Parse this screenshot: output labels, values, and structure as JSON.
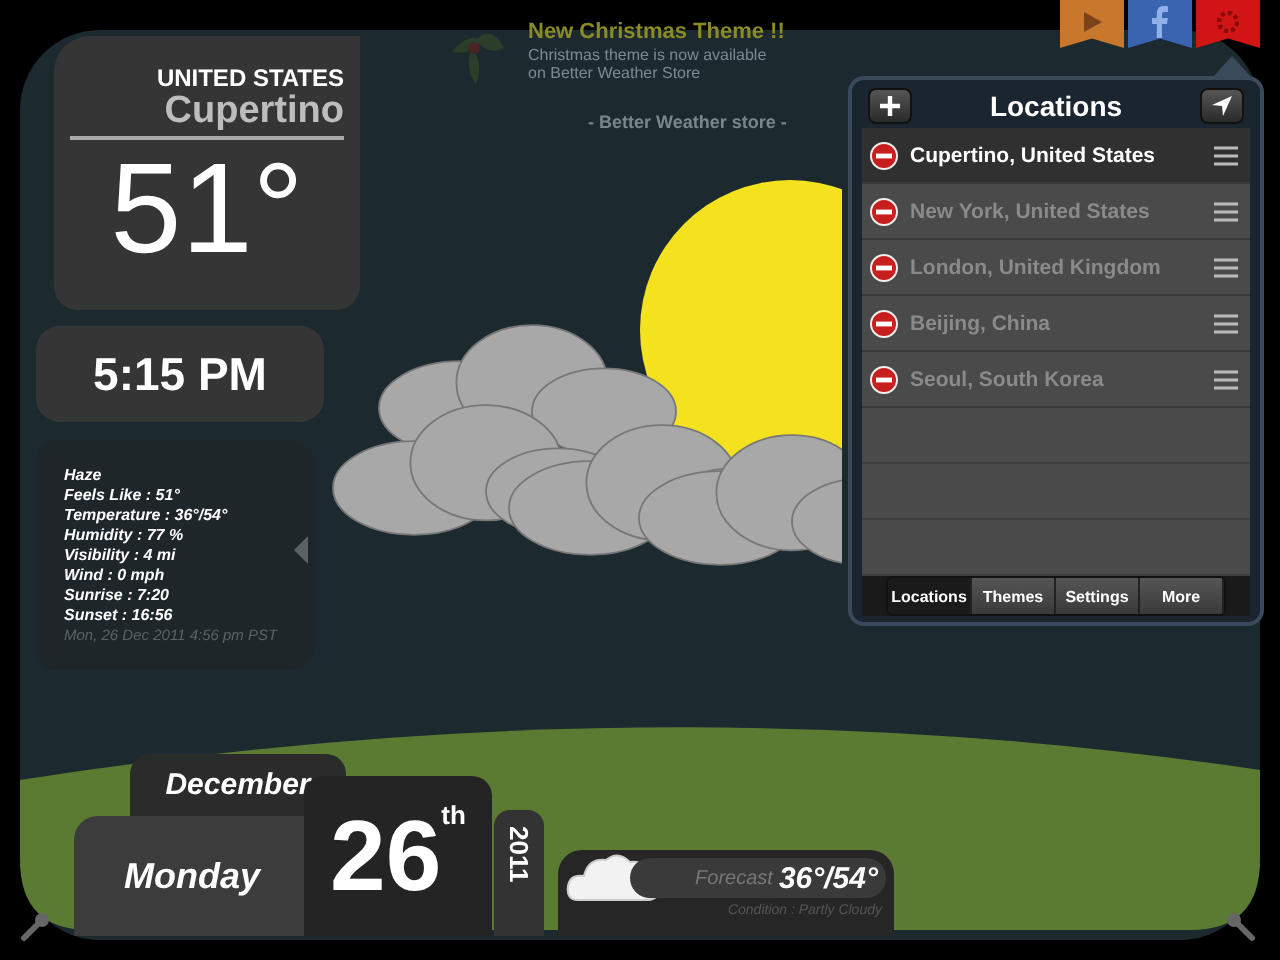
{
  "notification": {
    "title": "New Christmas Theme !!",
    "message": "Christmas theme is now available on Better Weather Store",
    "source": "- Better Weather store -"
  },
  "location": {
    "country": "UNITED STATES",
    "city": "Cupertino",
    "temperature": "51°"
  },
  "time": "5:15 PM",
  "details": {
    "condition": "Haze",
    "lines": [
      "Feels Like : 51°",
      "Temperature : 36°/54°",
      "Humidity : 77 %",
      "Visibility : 4 mi",
      "Wind : 0 mph",
      "Sunrise : 7:20",
      "Sunset : 16:56"
    ],
    "updated": "Mon, 26 Dec 2011 4:56 pm PST"
  },
  "date": {
    "month": "December",
    "weekday": "Monday",
    "day": "26",
    "suffix": "th",
    "year": "2011"
  },
  "forecast": {
    "label": "Forecast",
    "range": "36°/54°",
    "condition": "Condition : Partly Cloudy"
  },
  "top_buttons": [
    {
      "kind": "play",
      "color": "#c8772c"
    },
    {
      "kind": "facebook",
      "color": "#3b64b0"
    },
    {
      "kind": "settings",
      "color": "#d11414"
    }
  ],
  "popover": {
    "title": "Locations",
    "locations": [
      {
        "name": "Cupertino, United States",
        "selected": true
      },
      {
        "name": "New York, United States",
        "selected": false
      },
      {
        "name": "London, United Kingdom",
        "selected": false
      },
      {
        "name": "Beijing, China",
        "selected": false
      },
      {
        "name": "Seoul, South Korea",
        "selected": false
      }
    ],
    "tabs": [
      {
        "label": "Locations",
        "selected": true
      },
      {
        "label": "Themes",
        "selected": false
      },
      {
        "label": "Settings",
        "selected": false
      },
      {
        "label": "More",
        "selected": false
      }
    ]
  }
}
